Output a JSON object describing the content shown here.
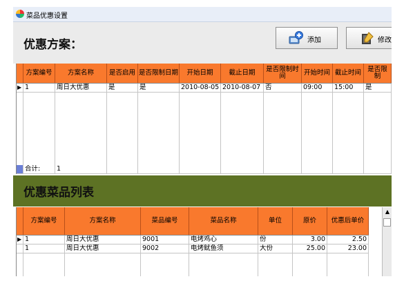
{
  "window": {
    "title": "菜品优惠设置"
  },
  "scheme_section": {
    "title": "优惠方案：",
    "buttons": [
      {
        "label": "添加",
        "icon": "add-icon"
      },
      {
        "label": "修改",
        "icon": "edit-icon"
      }
    ],
    "columns": [
      "方案编号",
      "方案名称",
      "是否启用",
      "是否限制日期",
      "开始日期",
      "截止日期",
      "是否限制时间",
      "开始时间",
      "截止时间",
      "是否限制"
    ],
    "rows": [
      [
        "1",
        "周日大优惠",
        "是",
        "是",
        "2010-08-05",
        "2010-08-07",
        "否",
        "09:00",
        "15:00",
        "是"
      ]
    ],
    "footer": {
      "label": "合计:",
      "count": "1"
    }
  },
  "dish_section": {
    "title": "优惠菜品列表",
    "columns": [
      "方案编号",
      "方案名称",
      "菜品编号",
      "菜品名称",
      "单位",
      "原价",
      "优惠后单价"
    ],
    "rows": [
      [
        "1",
        "周日大优惠",
        "9001",
        "电烤鸡心",
        "份",
        "3.00",
        "2.50"
      ],
      [
        "1",
        "周日大优惠",
        "9002",
        "电烤鱿鱼须",
        "大份",
        "25.00",
        "23.00"
      ]
    ]
  },
  "colors": {
    "grid_header": "#f9792d",
    "dish_banner": "#5d7224",
    "title_bar": "#e8eef8"
  }
}
